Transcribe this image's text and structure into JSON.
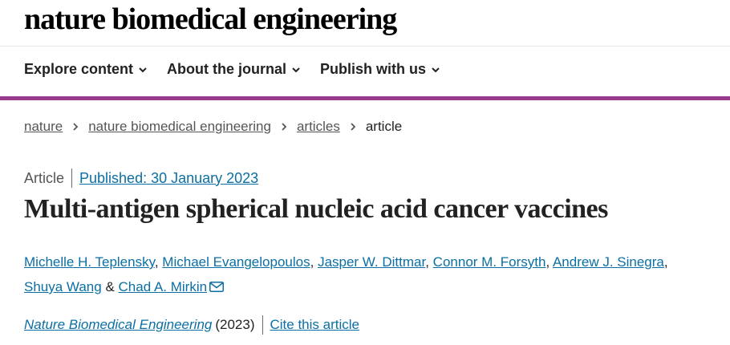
{
  "site": {
    "logo": "nature biomedical engineering"
  },
  "nav": {
    "items": [
      "Explore content",
      "About the journal",
      "Publish with us"
    ]
  },
  "breadcrumb": {
    "links": [
      "nature",
      "nature biomedical engineering",
      "articles"
    ],
    "current": "article"
  },
  "article": {
    "type": "Article",
    "published": "Published: 30 January 2023",
    "title": "Multi-antigen spherical nucleic acid cancer vaccines",
    "authors": [
      "Michelle H. Teplensky",
      "Michael Evangelopoulos",
      "Jasper W. Dittmar",
      "Connor M. Forsyth",
      "Andrew J. Sinegra",
      "Shuya Wang",
      "Chad A. Mirkin"
    ],
    "author_separator": ",",
    "author_and": "&",
    "journal": "Nature Biomedical Engineering",
    "year": "(2023)",
    "cite_label": "Cite this article"
  },
  "colors": {
    "accent": "#973b8f",
    "link": "#0b6fa4",
    "text": "#222222"
  },
  "icons": {
    "nav_chevron": "chevron-down-icon",
    "breadcrumb_sep": "chevron-right-icon",
    "author_mail": "mail-icon"
  }
}
